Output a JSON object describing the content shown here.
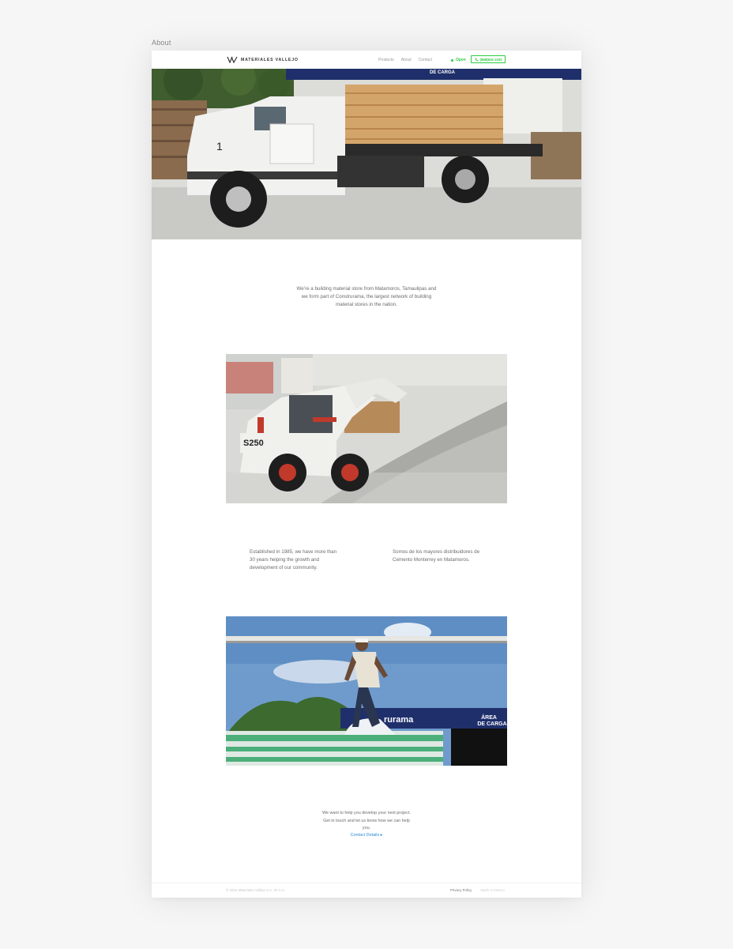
{
  "page_label": "About",
  "header": {
    "logo_text": "MATERIALES VALLEJO",
    "nav": [
      "Products",
      "About",
      "Contact"
    ],
    "status": "Open",
    "phone": "(868)816 1303"
  },
  "intro": "We’re a building material store from Matamoros, Tamaulipas and we form part of Construrama, the largest network of building material stores in the nation.",
  "columns": {
    "left": "Established in 1985, we have more than 30 years helping the growth and development of our community.",
    "right": "Somos de los mayores distribuidores de Cemento Monterrey en Matamoros."
  },
  "cta": {
    "text": "We want to help you develop your next project. Get in touch and let us know how we can help you.",
    "link": "Contact Details ▸"
  },
  "images": {
    "hero_sign": "DE CARGA",
    "skid_model": "S250",
    "sign_brand": "rurama",
    "sign_area_1": "ÁREA",
    "sign_area_2": "DE CARGA"
  },
  "footer": {
    "copyright": "© 2016 Materiales Vallejo S.A. de C.V.",
    "privacy": "Privacy Policy",
    "made_by": "Made in Mexico"
  },
  "colors": {
    "accent_green": "#2ecc40",
    "link_blue": "#2a8bd8",
    "sign_navy": "#1f2f6b"
  }
}
